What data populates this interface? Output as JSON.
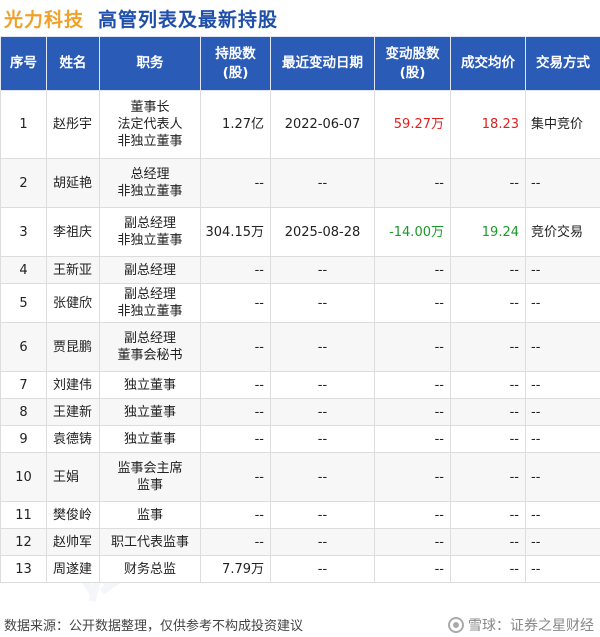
{
  "header": {
    "company": "光力科技",
    "subtitle": "高管列表及最新持股"
  },
  "columns": {
    "index": "序号",
    "name": "姓名",
    "position": "职务",
    "holding_1": "持股数",
    "holding_2": "(股)",
    "date": "最近变动日期",
    "change_1": "变动股数",
    "change_2": "(股)",
    "price": "成交均价",
    "method": "交易方式"
  },
  "rows": [
    {
      "index": "1",
      "name": "赵彤宇",
      "position": [
        "董事长",
        "法定代表人",
        "非独立董事"
      ],
      "holding": "1.27亿",
      "date": "2022-06-07",
      "change": "59.27万",
      "change_color": "#e02020",
      "price": "18.23",
      "price_color": "#e02020",
      "method": "集中竞价"
    },
    {
      "index": "2",
      "name": "胡延艳",
      "position": [
        "总经理",
        "非独立董事"
      ],
      "holding": "--",
      "date": "--",
      "change": "--",
      "change_color": "#222222",
      "price": "--",
      "price_color": "#222222",
      "method": "--"
    },
    {
      "index": "3",
      "name": "李祖庆",
      "position": [
        "副总经理",
        "非独立董事"
      ],
      "holding": "304.15万",
      "date": "2025-08-28",
      "change": "-14.00万",
      "change_color": "#1a9a2a",
      "price": "19.24",
      "price_color": "#1a9a2a",
      "method": "竞价交易"
    },
    {
      "index": "4",
      "name": "王新亚",
      "position": [
        "副总经理"
      ],
      "holding": "--",
      "date": "--",
      "change": "--",
      "change_color": "#222222",
      "price": "--",
      "price_color": "#222222",
      "method": "--"
    },
    {
      "index": "5",
      "name": "张健欣",
      "position": [
        "副总经理",
        "非独立董事"
      ],
      "holding": "--",
      "date": "--",
      "change": "--",
      "change_color": "#222222",
      "price": "--",
      "price_color": "#222222",
      "method": "--"
    },
    {
      "index": "6",
      "name": "贾昆鹏",
      "position": [
        "副总经理",
        "董事会秘书"
      ],
      "holding": "--",
      "date": "--",
      "change": "--",
      "change_color": "#222222",
      "price": "--",
      "price_color": "#222222",
      "method": "--"
    },
    {
      "index": "7",
      "name": "刘建伟",
      "position": [
        "独立董事"
      ],
      "holding": "--",
      "date": "--",
      "change": "--",
      "change_color": "#222222",
      "price": "--",
      "price_color": "#222222",
      "method": "--"
    },
    {
      "index": "8",
      "name": "王建新",
      "position": [
        "独立董事"
      ],
      "holding": "--",
      "date": "--",
      "change": "--",
      "change_color": "#222222",
      "price": "--",
      "price_color": "#222222",
      "method": "--"
    },
    {
      "index": "9",
      "name": "袁德铸",
      "position": [
        "独立董事"
      ],
      "holding": "--",
      "date": "--",
      "change": "--",
      "change_color": "#222222",
      "price": "--",
      "price_color": "#222222",
      "method": "--"
    },
    {
      "index": "10",
      "name": "王娟",
      "position": [
        "监事会主席",
        "监事"
      ],
      "holding": "--",
      "date": "--",
      "change": "--",
      "change_color": "#222222",
      "price": "--",
      "price_color": "#222222",
      "method": "--"
    },
    {
      "index": "11",
      "name": "樊俊岭",
      "position": [
        "监事"
      ],
      "holding": "--",
      "date": "--",
      "change": "--",
      "change_color": "#222222",
      "price": "--",
      "price_color": "#222222",
      "method": "--"
    },
    {
      "index": "12",
      "name": "赵帅军",
      "position": [
        "职工代表监事"
      ],
      "holding": "--",
      "date": "--",
      "change": "--",
      "change_color": "#222222",
      "price": "--",
      "price_color": "#222222",
      "method": "--"
    },
    {
      "index": "13",
      "name": "周遂建",
      "position": [
        "财务总监"
      ],
      "holding": "7.79万",
      "date": "--",
      "change": "--",
      "change_color": "#222222",
      "price": "--",
      "price_color": "#222222",
      "method": "--"
    }
  ],
  "footer": {
    "source": "数据来源：公开数据整理，仅供参考不构成投资建议",
    "brand": "雪球：证券之星财经"
  },
  "watermark_text": "证券之星"
}
